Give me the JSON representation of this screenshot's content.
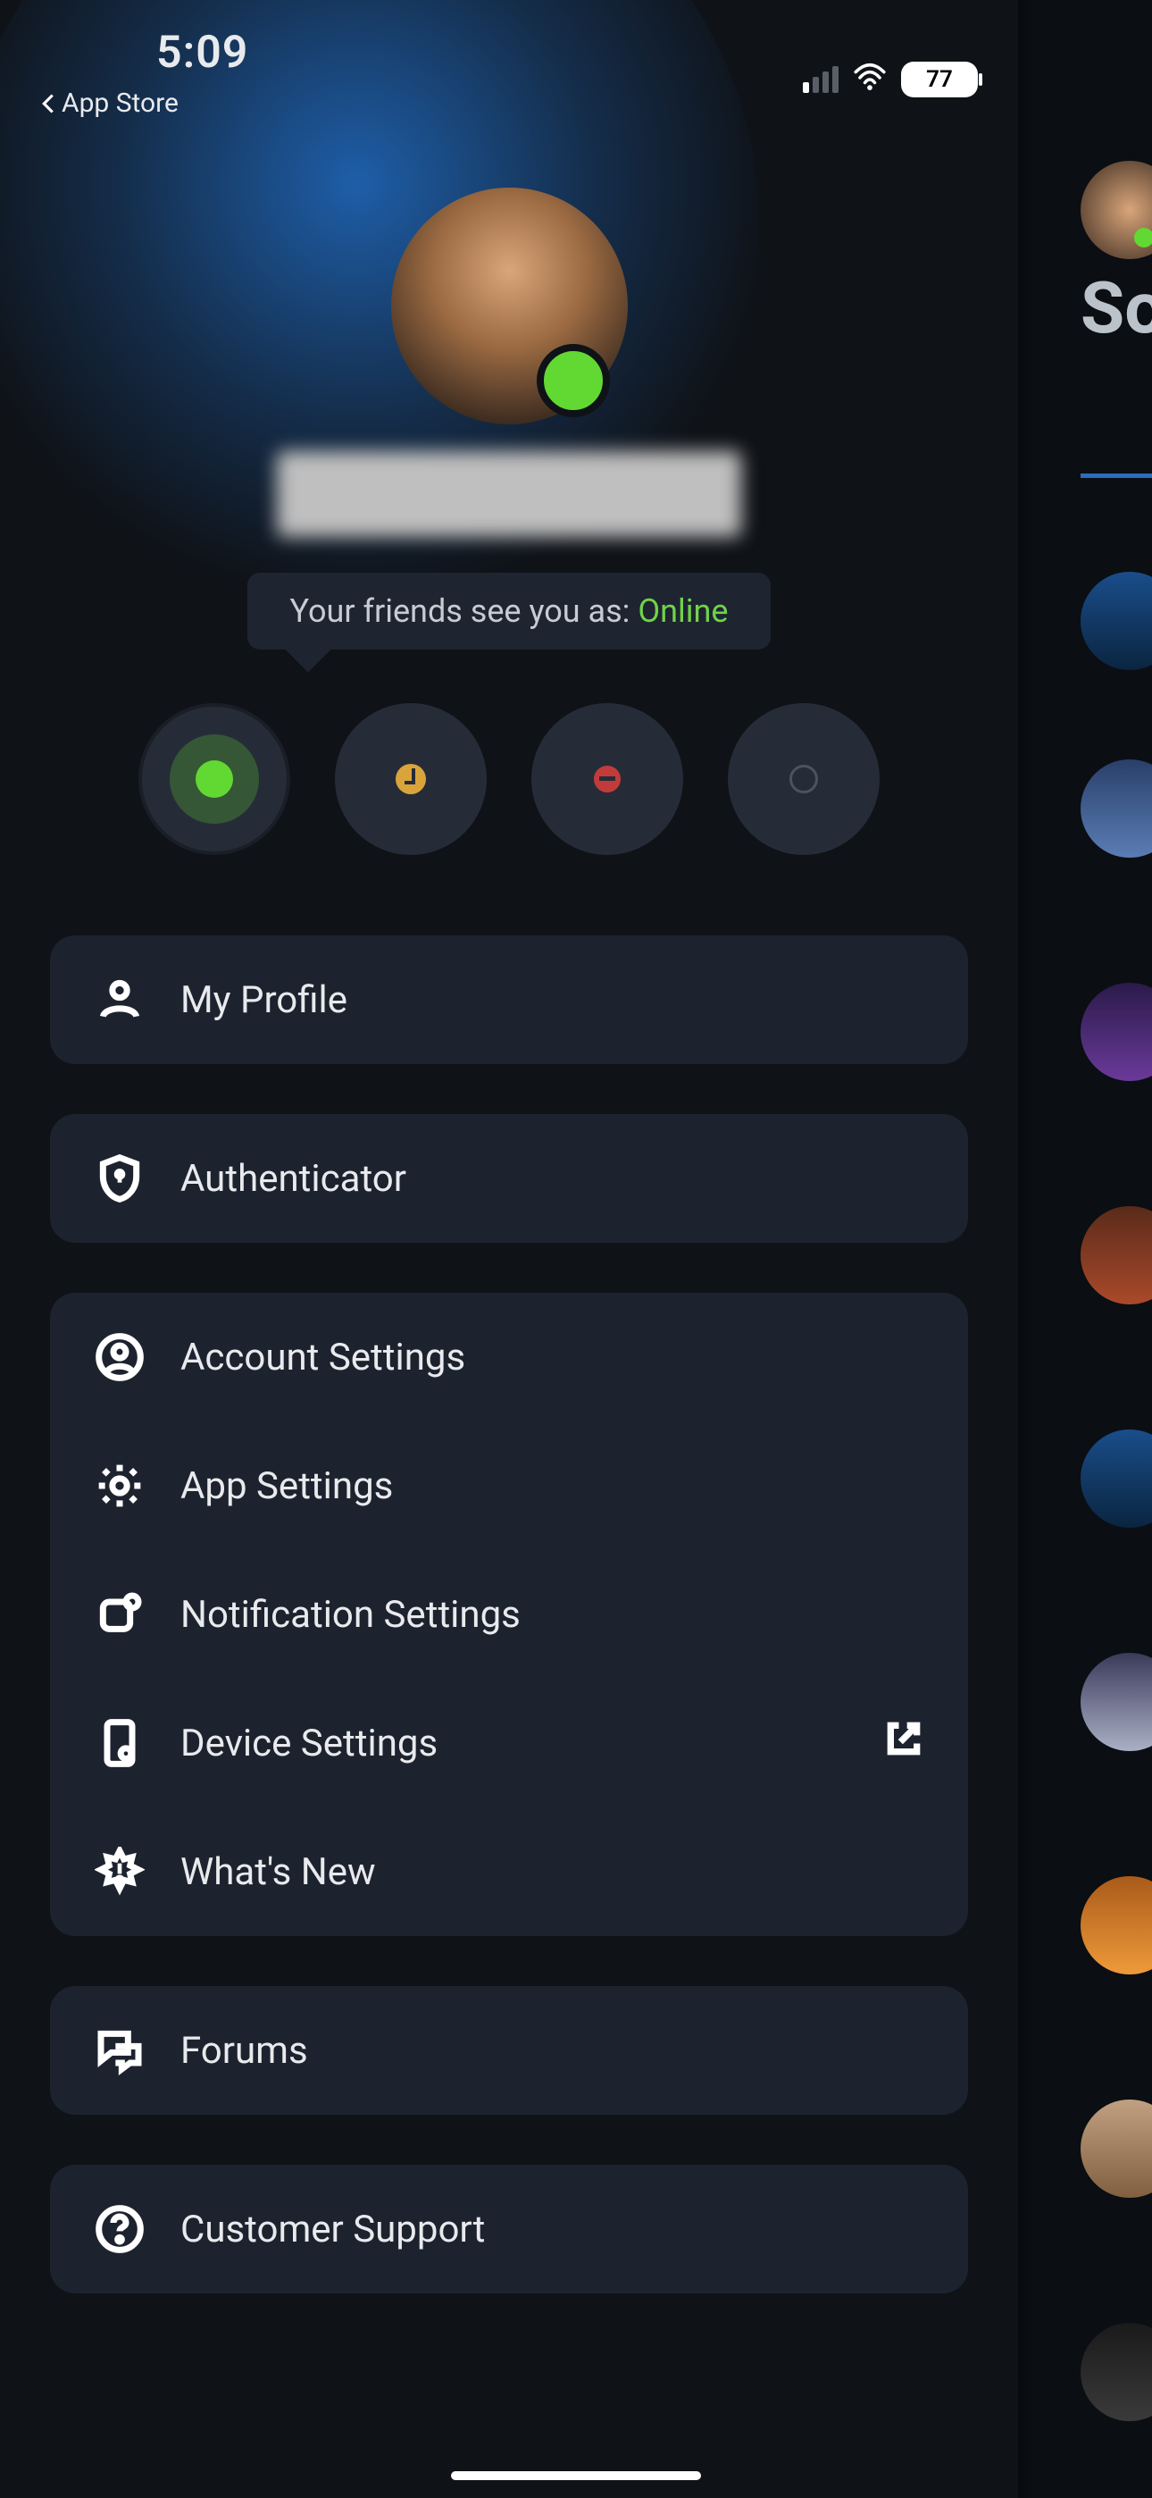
{
  "status_bar": {
    "time": "5:09",
    "back_label": "App Store",
    "battery": "77"
  },
  "profile": {
    "status_prefix": "Your friends see you as: ",
    "status_value": "Online"
  },
  "menu": {
    "my_profile": "My Profile",
    "authenticator": "Authenticator",
    "account_settings": "Account Settings",
    "app_settings": "App Settings",
    "notification_settings": "Notification Settings",
    "device_settings": "Device Settings",
    "whats_new": "What's New",
    "forums": "Forums",
    "customer_support": "Customer Support"
  },
  "peek": {
    "heading_fragment": "So"
  }
}
